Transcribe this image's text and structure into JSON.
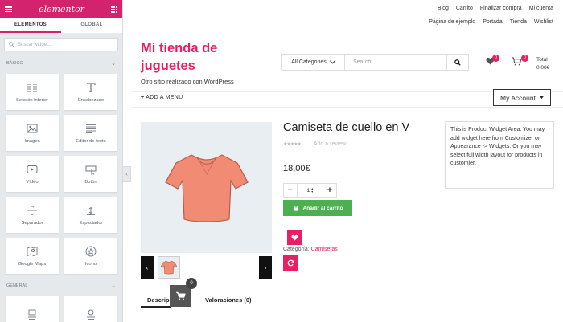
{
  "panel": {
    "logo": "elementor",
    "tabs": [
      "ELEMENTOS",
      "GLOBAL"
    ],
    "search_placeholder": "Buscar widget...",
    "section_basic": "BÁSICO",
    "section_general": "GENERAL",
    "basic_widgets": [
      {
        "label": "Sección interior",
        "icon": "columns-icon"
      },
      {
        "label": "Encabezado",
        "icon": "heading-icon"
      },
      {
        "label": "Imagen",
        "icon": "image-icon"
      },
      {
        "label": "Editor de texto",
        "icon": "text-editor-icon"
      },
      {
        "label": "Vídeo",
        "icon": "video-icon"
      },
      {
        "label": "Botón",
        "icon": "button-icon"
      },
      {
        "label": "Separador",
        "icon": "divider-icon"
      },
      {
        "label": "Espaciador",
        "icon": "spacer-icon"
      },
      {
        "label": "Google Maps",
        "icon": "map-icon"
      },
      {
        "label": "Icono",
        "icon": "star-icon"
      }
    ]
  },
  "site": {
    "top_links_row1": [
      "Blog",
      "Carrito",
      "Finalizar compra",
      "Mi cuenta"
    ],
    "top_links_row2": [
      "Página de ejemplo",
      "Portada",
      "Tienda",
      "Wishlist"
    ],
    "title": "Mi tienda de juguetes",
    "description": "Otro sitio realizado con WordPress",
    "search": {
      "category": "All Categories",
      "placeholder": "Search"
    },
    "wishlist_count": "0",
    "cart_count": "0",
    "cart_label": "Total",
    "cart_total": "0,00€",
    "add_menu": "ADD A MENU",
    "my_account": "My Account"
  },
  "product": {
    "title": "Camiseta de cuello en V",
    "review_link": "Add a review.",
    "price": "18,00€",
    "quantity": "1",
    "add_to_cart": "Añadir al carrito",
    "category_label": "Categoría:",
    "category_value": "Camisetas",
    "tabs": [
      "Descripción",
      "Valoraciones (0)"
    ],
    "floating_cart_count": "0",
    "shirt_color": "#f28b74"
  },
  "widget_area": {
    "text": "This is Product Widget Area. You may add widget here from Customizer or Appearance -> Widgets. Or you may select full width layout for products in customier."
  }
}
